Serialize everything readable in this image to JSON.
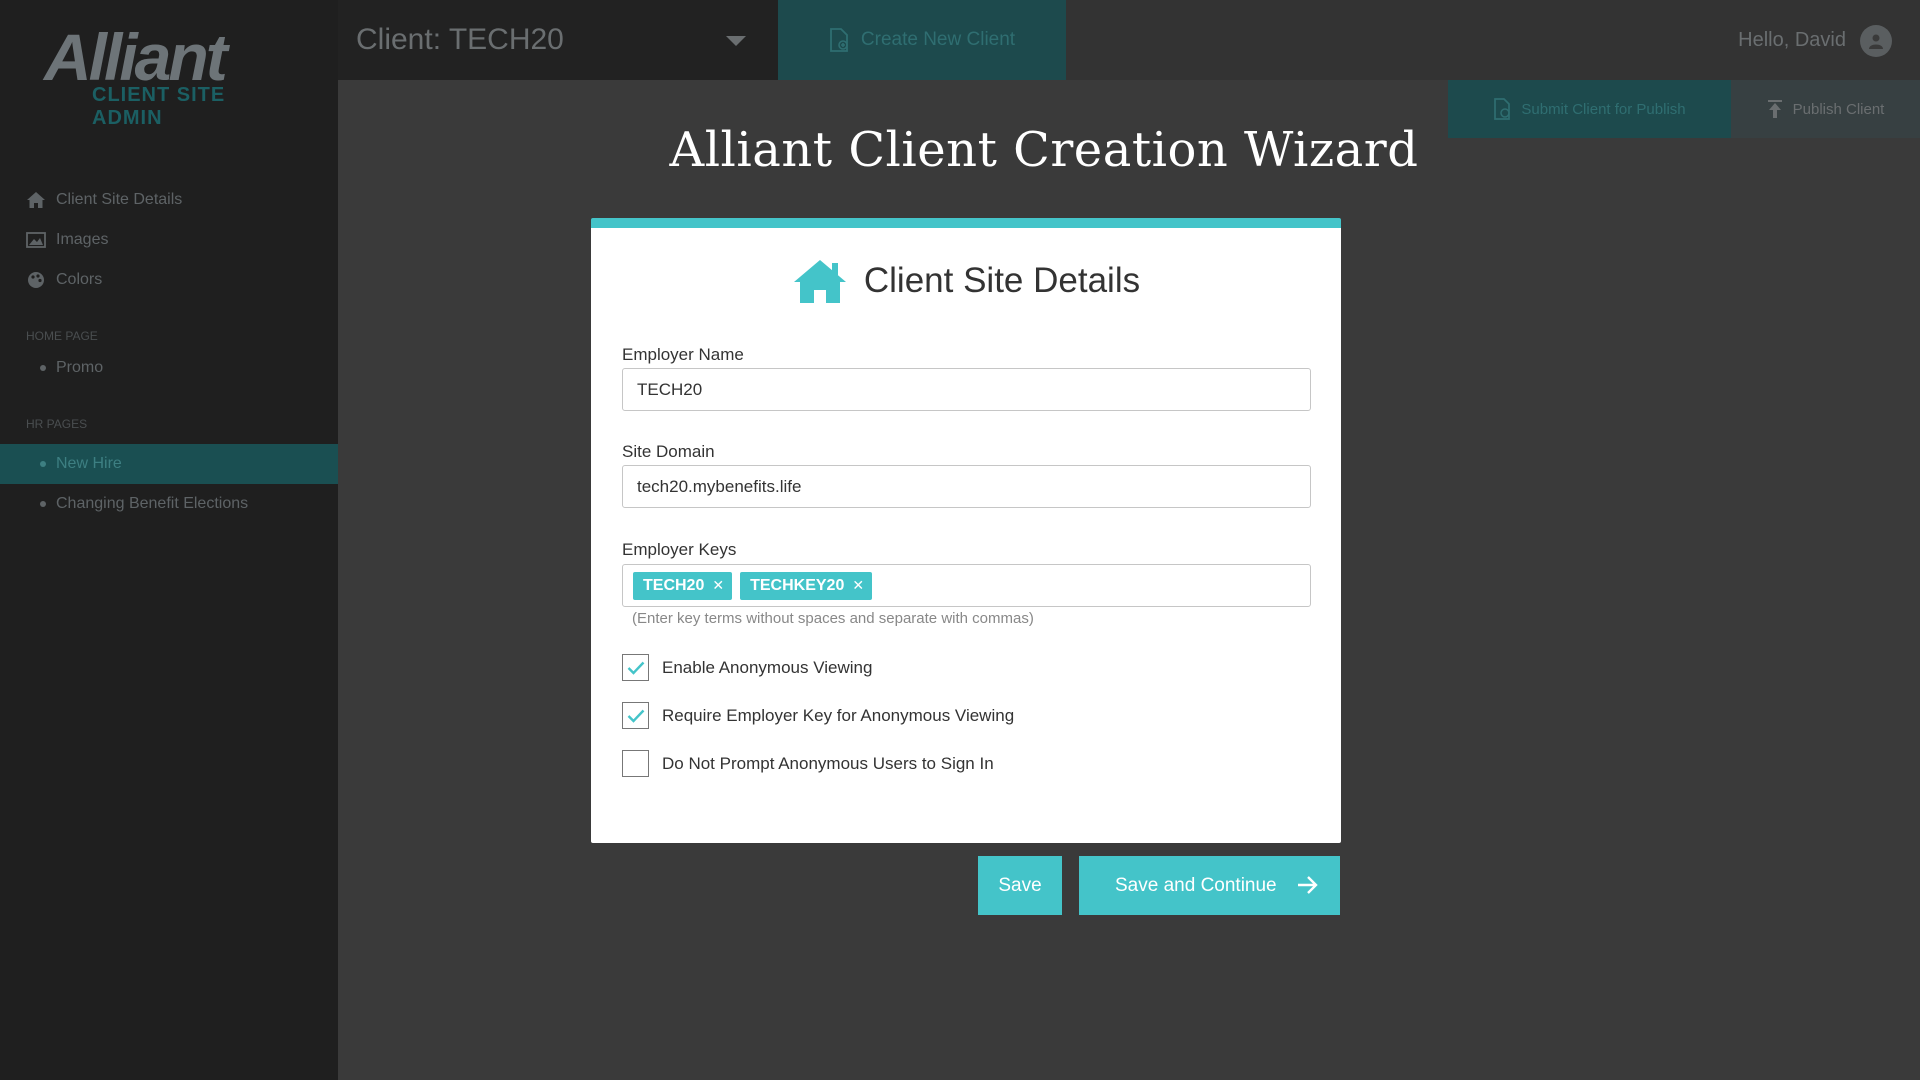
{
  "app": {
    "logo_text": "Alliant",
    "logo_subtitle": "CLIENT SITE ADMIN"
  },
  "sidebar": {
    "items": [
      {
        "label": "Client Site Details",
        "icon": "home-icon"
      },
      {
        "label": "Images",
        "icon": "image-icon"
      },
      {
        "label": "Colors",
        "icon": "palette-icon"
      }
    ],
    "sections": [
      {
        "title": "HOME PAGE",
        "items": [
          {
            "label": "Promo"
          }
        ]
      },
      {
        "title": "HR PAGES",
        "items": [
          {
            "label": "New Hire",
            "active": true
          },
          {
            "label": "Changing Benefit Elections"
          }
        ]
      }
    ]
  },
  "header": {
    "client_select": "Client: TECH20",
    "create_button": "Create New Client",
    "greeting": "Hello, David",
    "submit_button": "Submit Client for Publish",
    "publish_button": "Publish Client"
  },
  "wizard": {
    "title": "Alliant Client Creation Wizard",
    "card_title": "Client Site Details",
    "employer_name_label": "Employer Name",
    "employer_name_value": "TECH20",
    "site_domain_label": "Site Domain",
    "site_domain_value": "tech20.mybenefits.life",
    "employer_keys_label": "Employer Keys",
    "employer_keys": [
      "TECH20",
      "TECHKEY20"
    ],
    "keys_hint": "(Enter key terms without spaces and separate with commas)",
    "checkboxes": [
      {
        "label": "Enable Anonymous Viewing",
        "checked": true
      },
      {
        "label": "Require Employer Key for Anonymous Viewing",
        "checked": true
      },
      {
        "label": "Do Not Prompt Anonymous Users to Sign In",
        "checked": false
      }
    ],
    "save_button": "Save",
    "save_continue_button": "Save and Continue"
  },
  "colors": {
    "accent": "#44c4c9",
    "sidebar_bg": "#1f1f1f",
    "overlay_bg": "#3a3a3a"
  }
}
